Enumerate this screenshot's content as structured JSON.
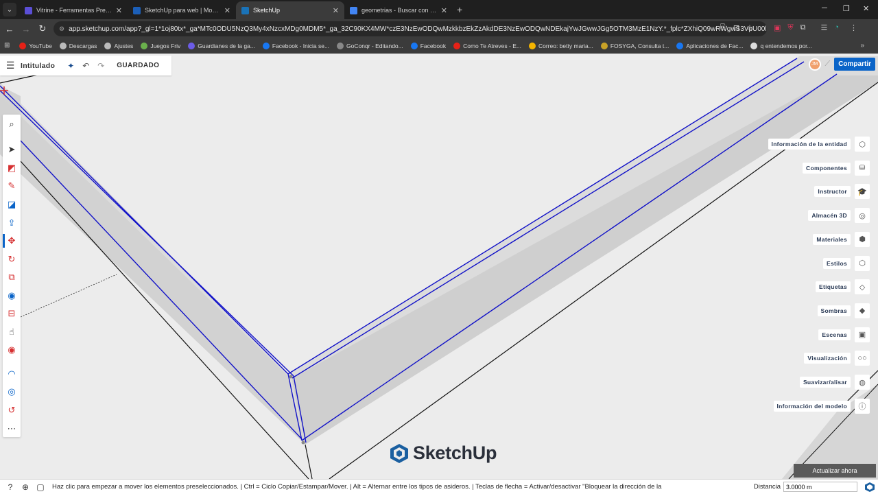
{
  "browser": {
    "tabs": [
      {
        "title": "Vitrine - Ferramentas Premium",
        "color": "#5b4fd6"
      },
      {
        "title": "SketchUp para web | Modelado",
        "color": "#1c5fb8"
      },
      {
        "title": "SketchUp",
        "color": "#1a73b8"
      },
      {
        "title": "geometrias - Buscar con Google",
        "color": "#4285f4"
      }
    ],
    "active_tab": 2,
    "url": "app.sketchup.com/app?_gl=1*1oj80tx*_ga*MTc0ODU5NzQ3My4xNzcxMDg0MDM5*_ga_32C90KX4MW*czE3NzEwODQwMzkkbzEkZzAkdDE3NzEwODQwNDEkajYwJGwwJGg5OTM3MzE1NzY.*_fplc*ZXhiQ09wRWgwS3VpU00lMkJ...",
    "bookmarks": [
      {
        "label": "YouTube",
        "color": "#e62117"
      },
      {
        "label": "Descargas",
        "color": "#bbbbbb"
      },
      {
        "label": "Ajustes",
        "color": "#bbbbbb"
      },
      {
        "label": "Juegos Friv",
        "color": "#6ab04c"
      },
      {
        "label": "Guardianes de la ga...",
        "color": "#6c5ce7"
      },
      {
        "label": "Facebook - Inicia se...",
        "color": "#1877f2"
      },
      {
        "label": "GoConqr - Editando...",
        "color": "#888888"
      },
      {
        "label": "Facebook",
        "color": "#1877f2"
      },
      {
        "label": "Como Te Atreves - E...",
        "color": "#e62117"
      },
      {
        "label": "Correo: betty maria...",
        "color": "#f4b400"
      },
      {
        "label": "FOSYGA, Consulta t...",
        "color": "#c9a227"
      },
      {
        "label": "Aplicaciones de Fac...",
        "color": "#1877f2"
      },
      {
        "label": "q entendemos por...",
        "color": "#dddddd"
      }
    ]
  },
  "app": {
    "document_title": "Intitulado",
    "save_state": "GUARDADO",
    "avatar_initials": "JM",
    "share_label": "Compartir",
    "right_panel": [
      {
        "label": "Información de la entidad",
        "icon": "cube-outline-icon",
        "glyph": "⬡"
      },
      {
        "label": "Componentes",
        "icon": "components-icon",
        "glyph": "⛁"
      },
      {
        "label": "Instructor",
        "icon": "graduation-cap-icon",
        "glyph": "🎓"
      },
      {
        "label": "Almacén 3D",
        "icon": "warehouse-icon",
        "glyph": "◎"
      },
      {
        "label": "Materiales",
        "icon": "materials-icon",
        "glyph": "⬢"
      },
      {
        "label": "Estilos",
        "icon": "styles-icon",
        "glyph": "⬡"
      },
      {
        "label": "Etiquetas",
        "icon": "tag-icon",
        "glyph": "◇"
      },
      {
        "label": "Sombras",
        "icon": "shadows-icon",
        "glyph": "◆"
      },
      {
        "label": "Escenas",
        "icon": "scenes-icon",
        "glyph": "▣"
      },
      {
        "label": "Visualización",
        "icon": "glasses-icon",
        "glyph": "○○"
      },
      {
        "label": "Suavizar/alisar",
        "icon": "soften-icon",
        "glyph": "◍"
      },
      {
        "label": "Información del modelo",
        "icon": "info-icon",
        "glyph": "ⓘ"
      }
    ],
    "tools": [
      {
        "name": "search-tool",
        "glyph": "⌕",
        "color": "#333333"
      },
      {
        "name": "select-tool",
        "glyph": "➤",
        "color": "#333333"
      },
      {
        "name": "eraser-tool",
        "glyph": "◩",
        "color": "#d63031"
      },
      {
        "name": "pencil-tool",
        "glyph": "✎",
        "color": "#d63031"
      },
      {
        "name": "rectangle-tool",
        "glyph": "◪",
        "color": "#0a64c8"
      },
      {
        "name": "push-pull-tool",
        "glyph": "⇪",
        "color": "#0a64c8"
      },
      {
        "name": "move-tool",
        "glyph": "✥",
        "color": "#d63031"
      },
      {
        "name": "rotate-tool",
        "glyph": "↻",
        "color": "#d63031"
      },
      {
        "name": "scale-tool",
        "glyph": "⧉",
        "color": "#d63031"
      },
      {
        "name": "paint-bucket-tool",
        "glyph": "◉",
        "color": "#0a64c8"
      },
      {
        "name": "section-plane-tool",
        "glyph": "⊟",
        "color": "#d63031"
      },
      {
        "name": "tape-measure-tool",
        "glyph": "☝",
        "color": "#333333"
      },
      {
        "name": "walk-tool",
        "glyph": "◉",
        "color": "#d63031"
      },
      {
        "name": "orbit-tool",
        "glyph": "◠",
        "color": "#0a64c8"
      },
      {
        "name": "circle-tool",
        "glyph": "◎",
        "color": "#0a64c8"
      },
      {
        "name": "arc-tool",
        "glyph": "↺",
        "color": "#d63031"
      },
      {
        "name": "more-tools",
        "glyph": "⋯",
        "color": "#555555"
      }
    ],
    "active_tool": 6,
    "logo_text": "SketchUp",
    "update_label": "Actualizar ahora",
    "status_text": "Haz clic para empezar a mover los elementos preseleccionados. | Ctrl = Ciclo Copiar/Estampar/Mover. | Alt = Alternar entre los tipos de asideros. | Teclas de flecha = Activar/desactivar \"Bloquear la dirección de la",
    "measure_label": "Distancia",
    "measure_value": "3.0000 m",
    "colors": {
      "accent": "#0a64c8",
      "selection": "#1010c8",
      "face": "#d9d9d9"
    }
  }
}
